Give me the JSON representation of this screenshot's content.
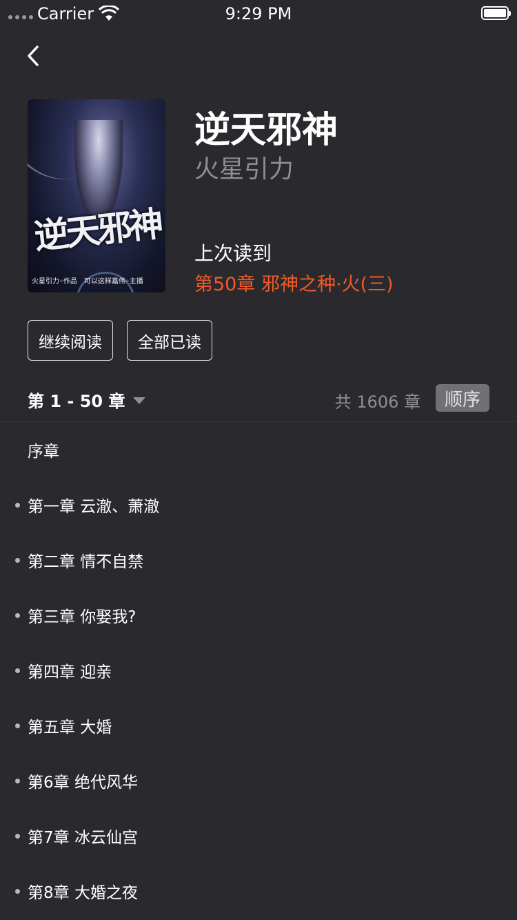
{
  "status_bar": {
    "carrier": "Carrier",
    "time": "9:29 PM",
    "battery_level": 1.0
  },
  "nav": {
    "back_icon": "chevron-left-icon"
  },
  "book": {
    "title": "逆天邪神",
    "author": "火星引力",
    "cover_art_title": "逆天邪神",
    "cover_credit": "火星引力◦作品　可以这样嘉伟◦主播"
  },
  "last_read": {
    "label": "上次读到",
    "chapter": "第50章 邪神之种·火(三)",
    "accent_color": "#f05a28"
  },
  "actions": {
    "continue_label": "继续阅读",
    "mark_all_read_label": "全部已读"
  },
  "chapter_header": {
    "range_label": "第 1 - 50 章",
    "total_label": "共 1606 章",
    "order_label": "顺序"
  },
  "chapters": [
    {
      "title": "序章",
      "unread": false
    },
    {
      "title": "第一章 云澈、萧澈",
      "unread": true
    },
    {
      "title": "第二章 情不自禁",
      "unread": true
    },
    {
      "title": "第三章 你娶我?",
      "unread": true
    },
    {
      "title": "第四章 迎亲",
      "unread": true
    },
    {
      "title": "第五章 大婚",
      "unread": true
    },
    {
      "title": "第6章 绝代风华",
      "unread": true
    },
    {
      "title": "第7章 冰云仙宫",
      "unread": true
    },
    {
      "title": "第8章 大婚之夜",
      "unread": true
    }
  ]
}
